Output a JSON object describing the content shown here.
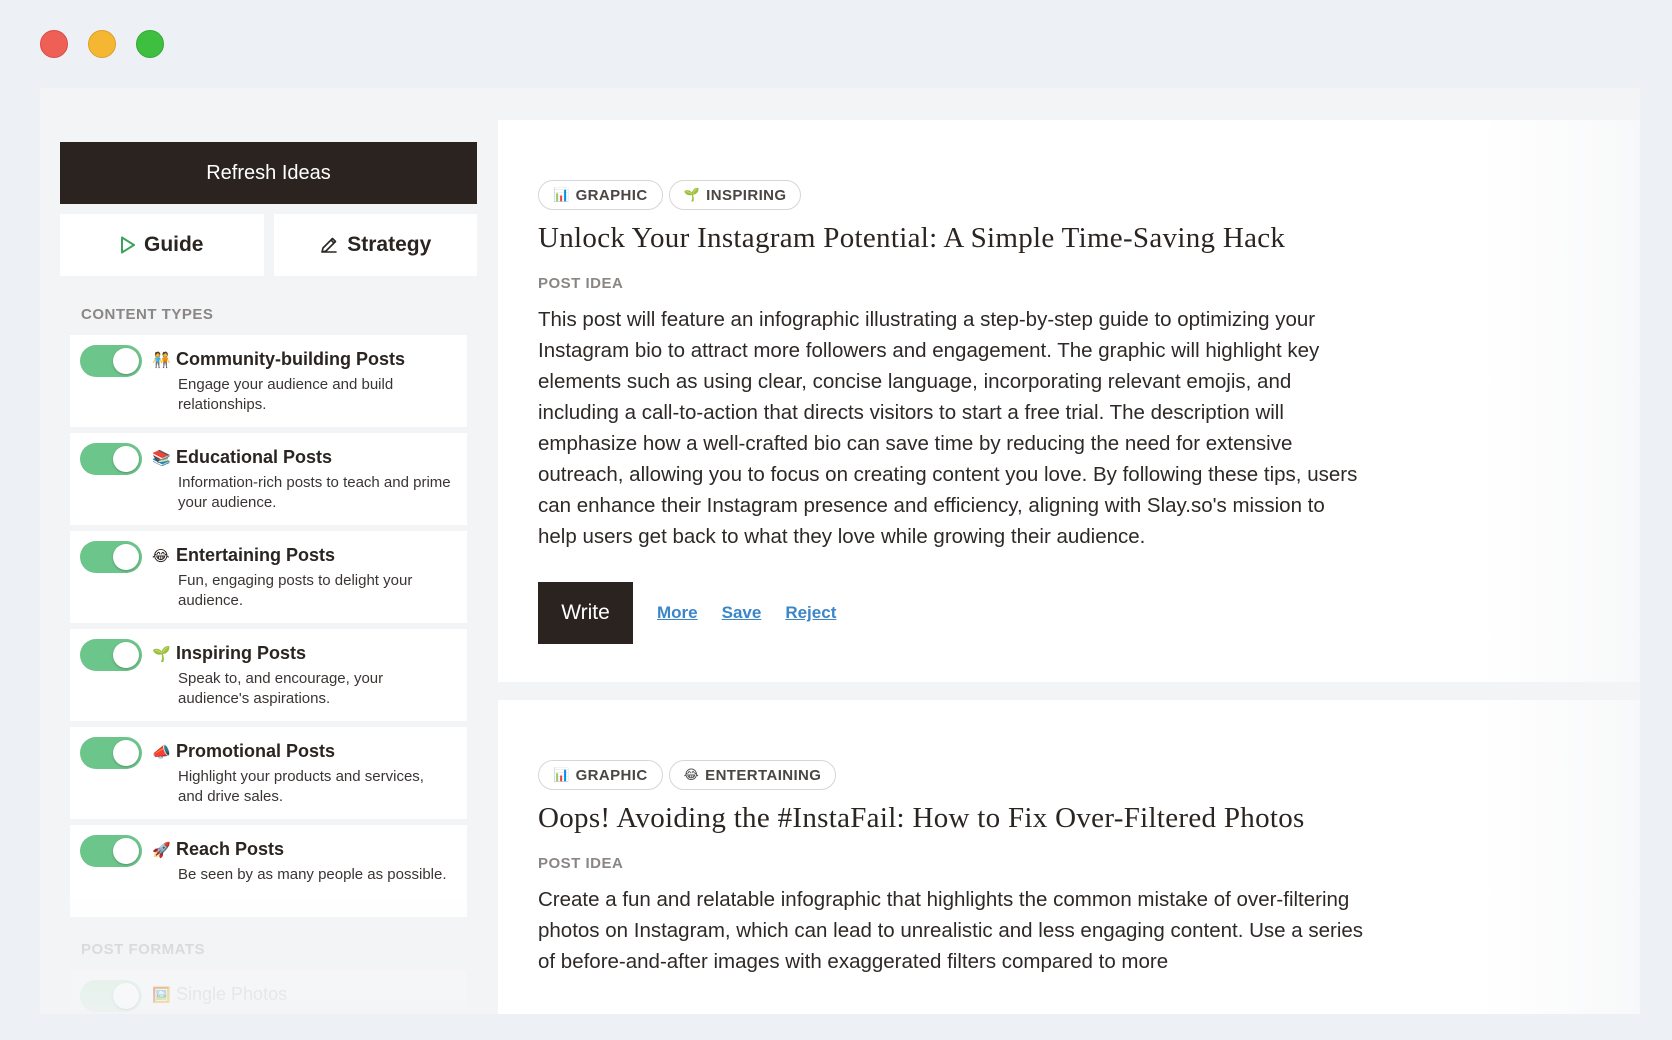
{
  "window": {
    "controls": [
      "close",
      "minimize",
      "maximize"
    ]
  },
  "sidebar": {
    "refresh_label": "Refresh Ideas",
    "guide_label": "Guide",
    "strategy_label": "Strategy",
    "content_types_label": "CONTENT TYPES",
    "content_types": [
      {
        "emoji": "🧑‍🤝‍🧑",
        "title": "Community-building Posts",
        "desc": "Engage your audience and build relationships.",
        "enabled": true
      },
      {
        "emoji": "📚",
        "title": "Educational Posts",
        "desc": "Information-rich posts to teach and prime your audience.",
        "enabled": true
      },
      {
        "emoji": "😂",
        "title": "Entertaining Posts",
        "desc": "Fun, engaging posts to delight your audience.",
        "enabled": true
      },
      {
        "emoji": "🌱",
        "title": "Inspiring Posts",
        "desc": "Speak to, and encourage, your audience's aspirations.",
        "enabled": true
      },
      {
        "emoji": "📣",
        "title": "Promotional Posts",
        "desc": "Highlight your products and services, and drive sales.",
        "enabled": true
      },
      {
        "emoji": "🚀",
        "title": "Reach Posts",
        "desc": "Be seen by as many people as possible.",
        "enabled": true
      }
    ],
    "post_formats_label": "POST FORMATS",
    "post_formats": [
      {
        "emoji": "🖼️",
        "title": "Single Photos",
        "enabled": true
      }
    ]
  },
  "posts": [
    {
      "tags": [
        {
          "icon": "📊",
          "label": "GRAPHIC"
        },
        {
          "icon": "🌱",
          "label": "INSPIRING"
        }
      ],
      "title": "Unlock Your Instagram Potential: A Simple Time-Saving Hack",
      "kicker": "POST IDEA",
      "body": "This post will feature an infographic illustrating a step-by-step guide to optimizing your Instagram bio to attract more followers and engagement. The graphic will highlight key elements such as using clear, concise language, incorporating relevant emojis, and including a call-to-action that directs visitors to start a free trial. The description will emphasize how a well-crafted bio can save time by reducing the need for extensive outreach, allowing you to focus on creating content you love. By following these tips, users can enhance their Instagram presence and efficiency, aligning with Slay.so's mission to help users get back to what they love while growing their audience.",
      "write_label": "Write",
      "more_label": "More",
      "save_label": "Save",
      "reject_label": "Reject"
    },
    {
      "tags": [
        {
          "icon": "📊",
          "label": "GRAPHIC"
        },
        {
          "icon": "😂",
          "label": "ENTERTAINING"
        }
      ],
      "title": "Oops! Avoiding the #InstaFail: How to Fix Over-Filtered Photos",
      "kicker": "POST IDEA",
      "body": "Create a fun and relatable infographic that highlights the common mistake of over-filtering photos on Instagram, which can lead to unrealistic and less engaging content. Use a series of before-and-after images with exaggerated filters compared to more"
    }
  ]
}
